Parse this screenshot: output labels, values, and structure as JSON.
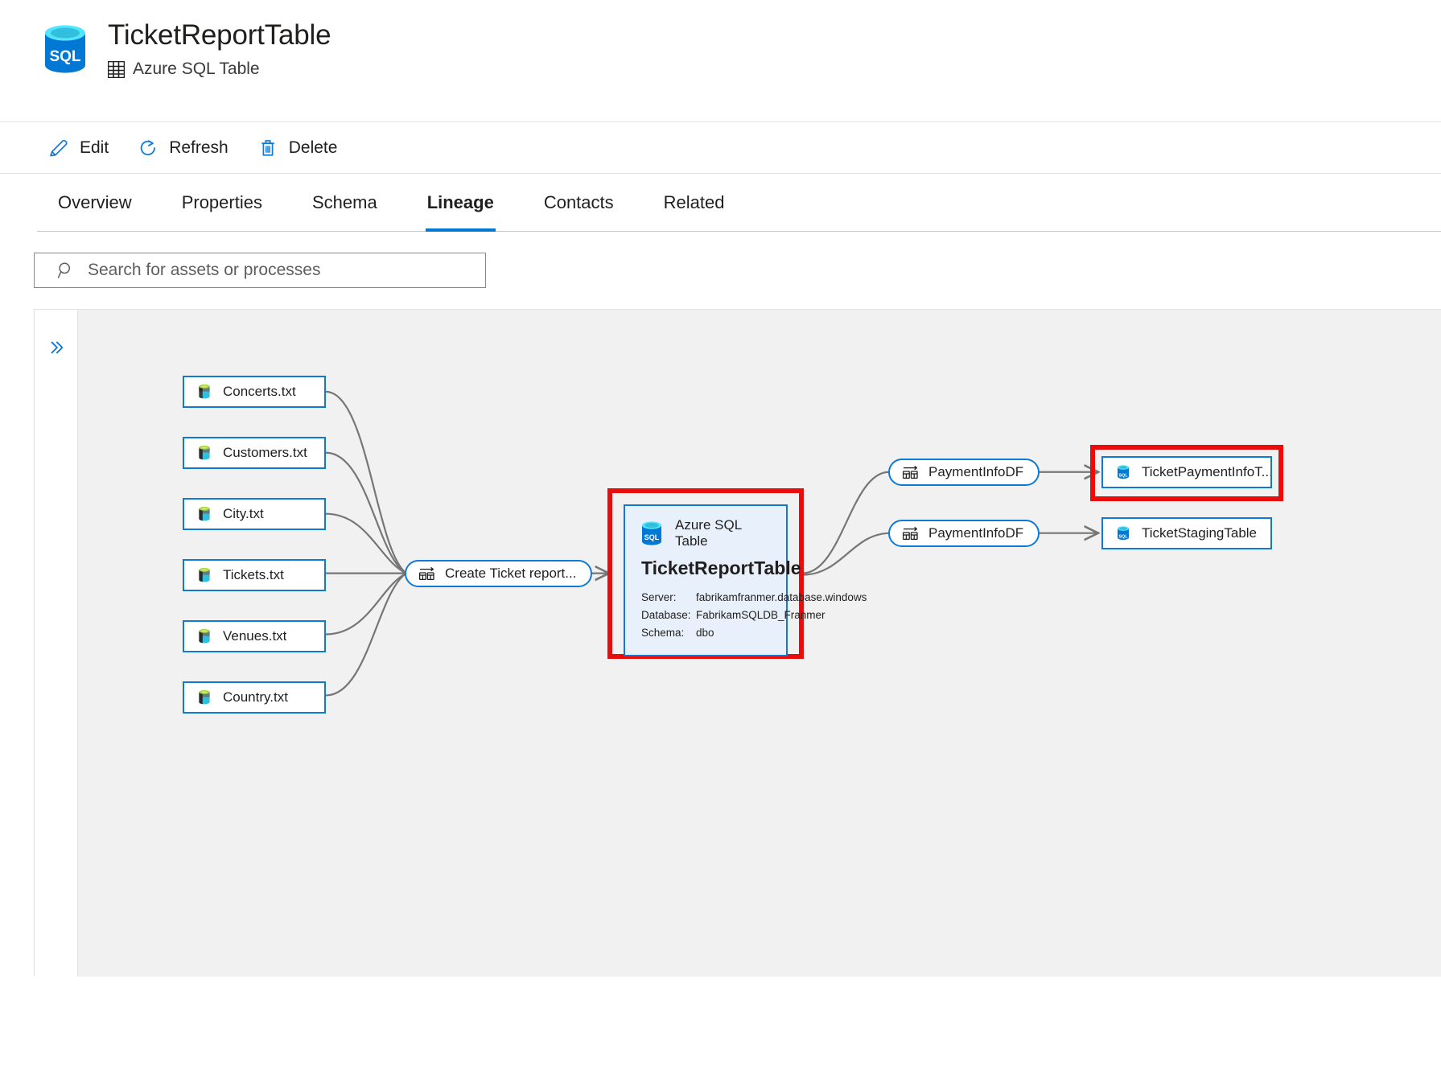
{
  "header": {
    "title": "TicketReportTable",
    "subtitle": "Azure SQL Table",
    "logo_icon": "azure-sql-database-icon",
    "subtitle_icon": "table-grid-icon"
  },
  "command_bar": {
    "buttons": [
      {
        "label": "Edit",
        "icon": "pencil-icon"
      },
      {
        "label": "Refresh",
        "icon": "refresh-circular-arrow-icon"
      },
      {
        "label": "Delete",
        "icon": "trash-bin-icon"
      }
    ]
  },
  "tabs": {
    "items": [
      {
        "label": "Overview",
        "active": false
      },
      {
        "label": "Properties",
        "active": false
      },
      {
        "label": "Schema",
        "active": false
      },
      {
        "label": "Lineage",
        "active": true
      },
      {
        "label": "Contacts",
        "active": false
      },
      {
        "label": "Related",
        "active": false
      }
    ],
    "active_underline_color": "#0078d4"
  },
  "search": {
    "placeholder": "Search for assets or processes",
    "value": "",
    "icon": "magnifier-search-icon"
  },
  "lineage": {
    "rail_toggle_icon": "double-chevron-right-icon",
    "canvas_background": "#f1f1f1",
    "node_border_color": "#0f7ad4",
    "highlight_color": "#ea0b0b",
    "edge_color": "#767676",
    "sources": [
      {
        "label": "Concerts.txt",
        "icon": "file-dataset-icon"
      },
      {
        "label": "Customers.txt",
        "icon": "file-dataset-icon"
      },
      {
        "label": "City.txt",
        "icon": "file-dataset-icon"
      },
      {
        "label": "Tickets.txt",
        "icon": "file-dataset-icon"
      },
      {
        "label": "Venues.txt",
        "icon": "file-dataset-icon"
      },
      {
        "label": "Country.txt",
        "icon": "file-dataset-icon"
      }
    ],
    "process": {
      "label": "Create Ticket report...",
      "icon": "process-transform-icon"
    },
    "main_asset": {
      "type_label": "Azure SQL Table",
      "name": "TicketReportTable",
      "logo_icon": "azure-sql-database-icon",
      "properties": [
        {
          "key": "Server:",
          "value": "fabrikamfranmer.database.windows"
        },
        {
          "key": "Database:",
          "value": "FabrikamSQLDB_Franmer"
        },
        {
          "key": "Schema:",
          "value": "dbo"
        }
      ],
      "highlighted": true
    },
    "downstream_processes": [
      {
        "label": "PaymentInfoDF",
        "icon": "process-transform-icon"
      },
      {
        "label": "PaymentInfoDF",
        "icon": "process-transform-icon"
      }
    ],
    "downstream_assets": [
      {
        "label": "TicketPaymentInfoT...",
        "icon": "azure-sql-table-icon",
        "highlighted": true
      },
      {
        "label": "TicketStagingTable",
        "icon": "azure-sql-table-icon",
        "highlighted": false
      }
    ]
  }
}
